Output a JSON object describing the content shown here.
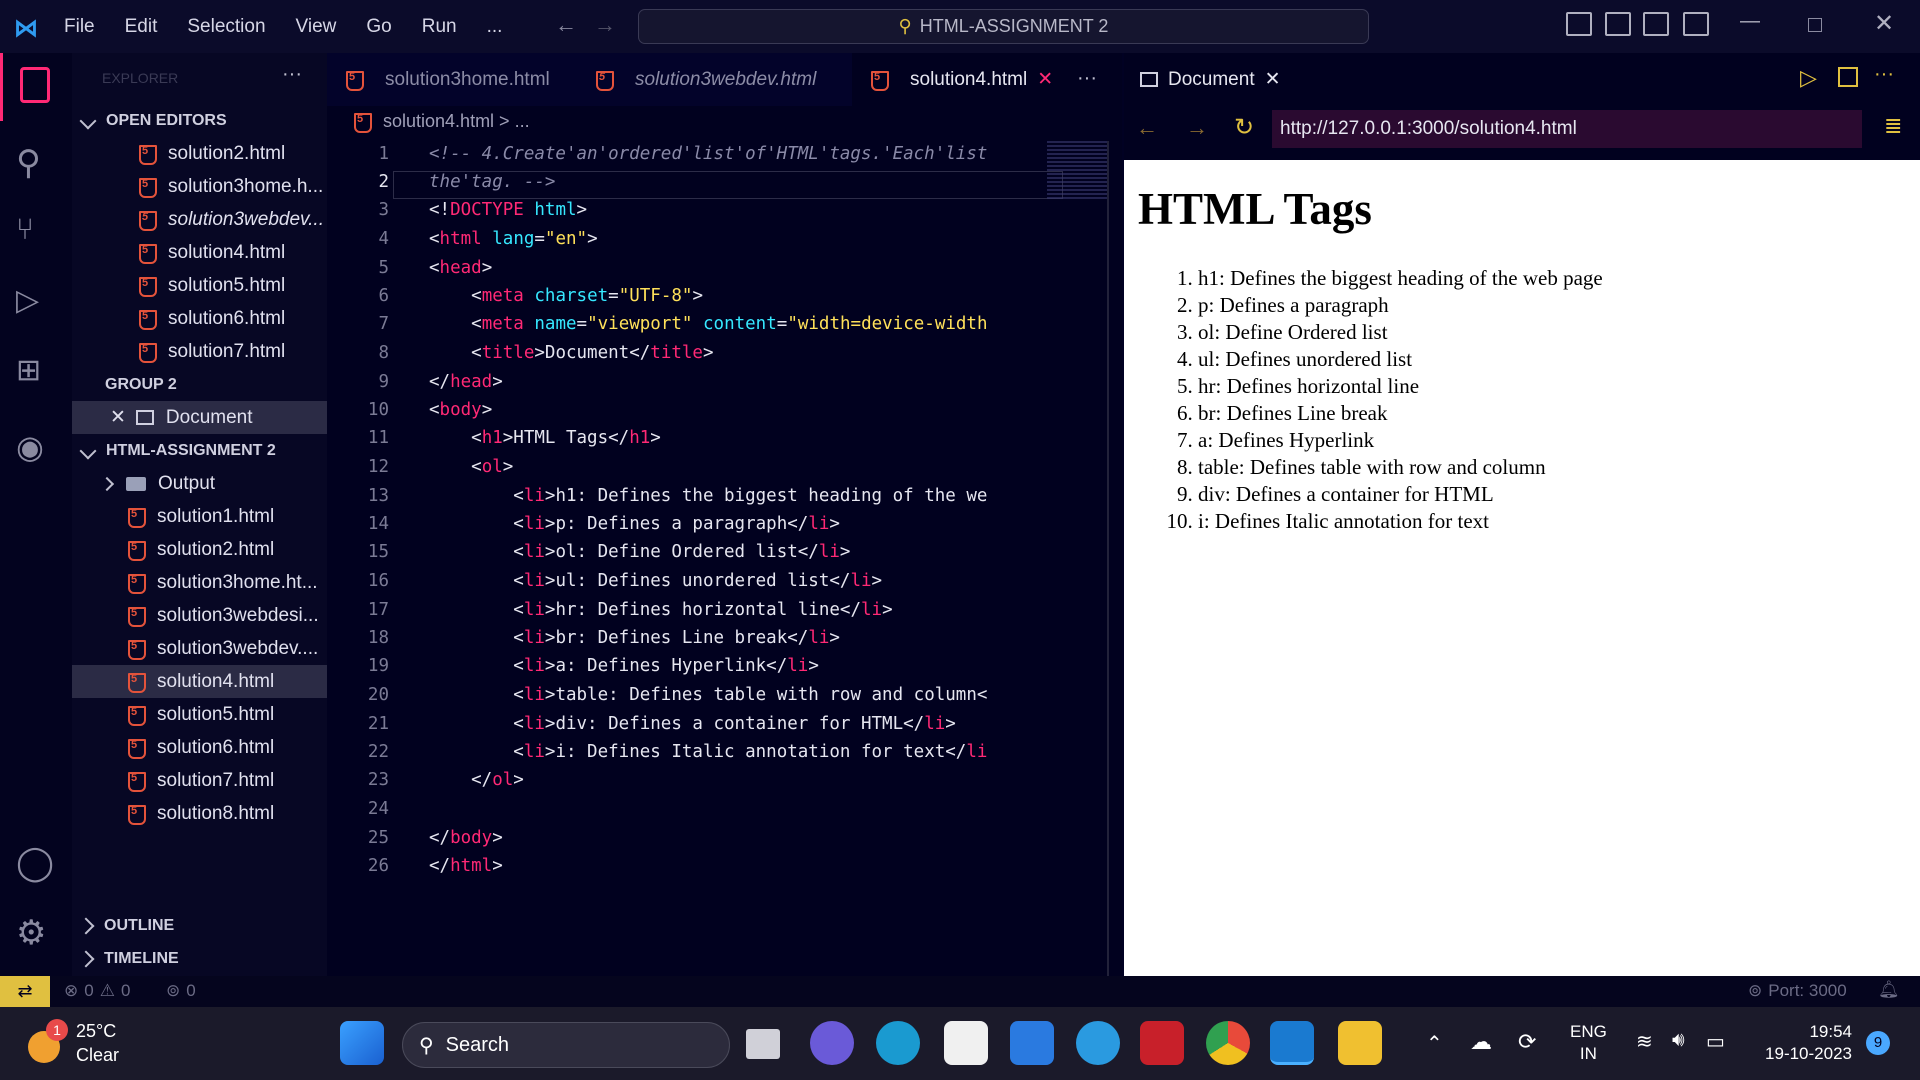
{
  "titlebar": {
    "menus": [
      "File",
      "Edit",
      "Selection",
      "View",
      "Go",
      "Run",
      "..."
    ],
    "search": "HTML-ASSIGNMENT 2"
  },
  "sidebar": {
    "explorer_label": "EXPLORER",
    "open_editors_label": "OPEN EDITORS",
    "open_editors": [
      "solution2.html",
      "solution3home.h...",
      "solution3webdev...",
      "solution4.html",
      "solution5.html",
      "solution6.html",
      "solution7.html"
    ],
    "group2_label": "GROUP 2",
    "group2_item": "Document",
    "project_label": "HTML-ASSIGNMENT 2",
    "folder": "Output",
    "files": [
      "solution1.html",
      "solution2.html",
      "solution3home.ht...",
      "solution3webdesi...",
      "solution3webdev....",
      "solution4.html",
      "solution5.html",
      "solution6.html",
      "solution7.html",
      "solution8.html"
    ],
    "outline_label": "OUTLINE",
    "timeline_label": "TIMELINE"
  },
  "editor": {
    "tabs": [
      "solution3home.html",
      "solution3webdev.html",
      "solution4.html"
    ],
    "breadcrumb": "solution4.html > ...",
    "line_numbers": [
      "1",
      "2",
      "3",
      "4",
      "5",
      "6",
      "7",
      "8",
      "9",
      "10",
      "11",
      "12",
      "13",
      "14",
      "15",
      "16",
      "17",
      "18",
      "19",
      "20",
      "21",
      "22",
      "23",
      "24",
      "25",
      "26"
    ]
  },
  "preview": {
    "tab": "Document",
    "url": "http://127.0.0.1:3000/solution4.html",
    "heading": "HTML Tags",
    "items": [
      "h1: Defines the biggest heading of the web page",
      "p: Defines a paragraph",
      "ol: Define Ordered list",
      "ul: Defines unordered list",
      "hr: Defines horizontal line",
      "br: Defines Line break",
      "a: Defines Hyperlink",
      "table: Defines table with row and column",
      "div: Defines a container for HTML",
      "i: Defines Italic annotation for text"
    ]
  },
  "status": {
    "errors": "0",
    "warnings": "0",
    "ports": "0",
    "port_label": "Port: 3000"
  },
  "taskbar": {
    "weather_temp": "25°C",
    "weather_desc": "Clear",
    "weather_badge": "1",
    "search": "Search",
    "lang1": "ENG",
    "lang2": "IN",
    "time": "19:54",
    "date": "19-10-2023",
    "notif": "9"
  }
}
